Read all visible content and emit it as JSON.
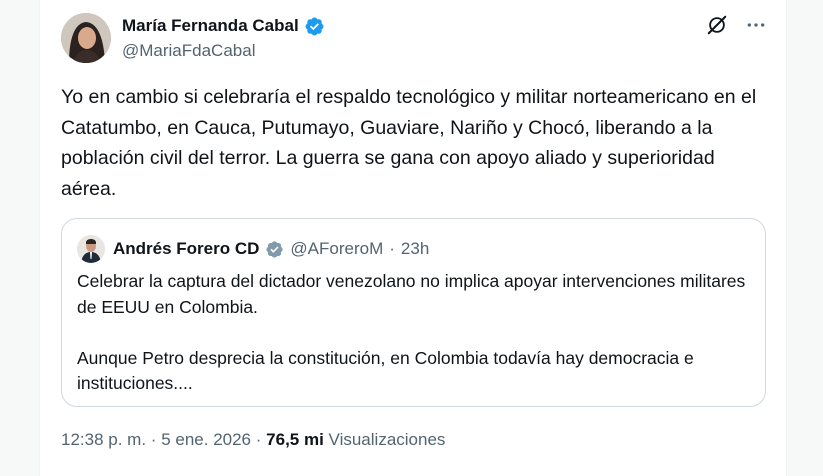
{
  "author": {
    "name": "María Fernanda Cabal",
    "handle": "@MariaFdaCabal"
  },
  "icons": {
    "verified": "verified-badge-icon",
    "grok": "grok-icon",
    "more": "more-options-icon"
  },
  "colors": {
    "verified_blue": "#1d9bf0",
    "verified_gray": "#829aab",
    "text_primary": "#0f1419",
    "text_secondary": "#536471",
    "border": "#cfd9de"
  },
  "tweet": {
    "text": "Yo en cambio si celebraría el respaldo tecnológico y militar norteamericano en el Catatumbo, en Cauca, Putumayo, Guaviare, Nariño y Chocó, liberando a la población civil del terror. La guerra se gana con apoyo aliado y superioridad aérea."
  },
  "quote": {
    "name": "Andrés Forero CD",
    "handle": "@AForeroM",
    "separator": "·",
    "time": "23h",
    "paragraphs": [
      "Celebrar la captura del dictador venezolano no implica apoyar intervenciones militares de EEUU en Colombia.",
      "Aunque Petro desprecia la constitución, en Colombia todavía hay democracia e instituciones...."
    ]
  },
  "meta": {
    "time": "12:38 p. m.",
    "separator": "·",
    "date": "5 ene. 2026",
    "views_count": "76,5 mi",
    "views_label": "Visualizaciones"
  }
}
